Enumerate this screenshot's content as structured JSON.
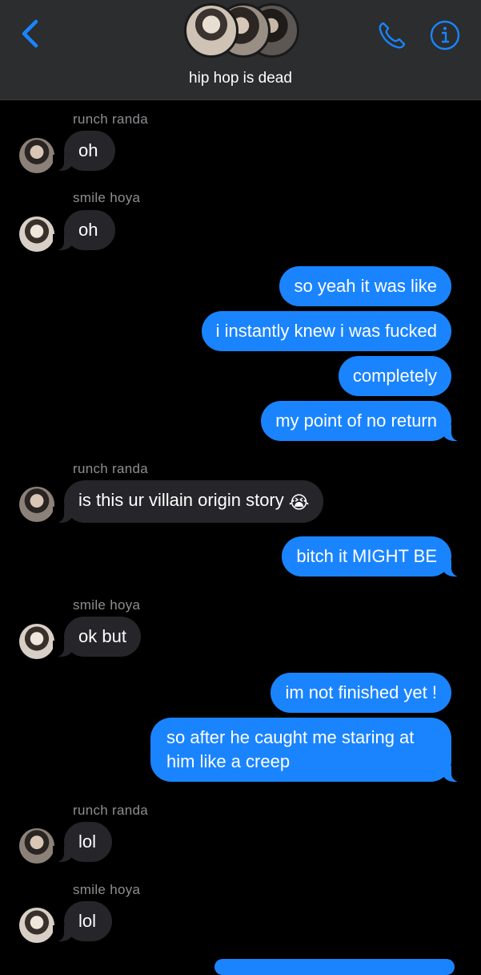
{
  "header": {
    "title": "hip hop is dead",
    "back_icon": "chevron-left-icon",
    "call_icon": "phone-icon",
    "info_icon": "info-icon",
    "accent_color": "#1a84ff"
  },
  "messages": [
    {
      "type": "in",
      "sender": "runch randa",
      "text": "oh"
    },
    {
      "type": "in",
      "sender": "smile hoya",
      "text": "oh"
    },
    {
      "type": "out",
      "text": "so yeah it was like"
    },
    {
      "type": "out",
      "text": "i instantly knew i was fucked"
    },
    {
      "type": "out",
      "text": "completely"
    },
    {
      "type": "out",
      "text": "my point of no return"
    },
    {
      "type": "in",
      "sender": "runch randa",
      "text": "is this ur villain origin story",
      "emoji": "😭"
    },
    {
      "type": "out",
      "text": "bitch it MIGHT BE"
    },
    {
      "type": "in",
      "sender": "smile hoya",
      "text": "ok but"
    },
    {
      "type": "out",
      "text": "im not finished yet !"
    },
    {
      "type": "out",
      "text": "so after he caught me staring at him like a creep"
    },
    {
      "type": "in",
      "sender": "runch randa",
      "text": "lol"
    },
    {
      "type": "in",
      "sender": "smile hoya",
      "text": "lol"
    }
  ],
  "colors": {
    "incoming_bubble": "#26252a",
    "outgoing_bubble": "#1a84ff",
    "background": "#000000",
    "sender_label": "#8e8e93"
  }
}
